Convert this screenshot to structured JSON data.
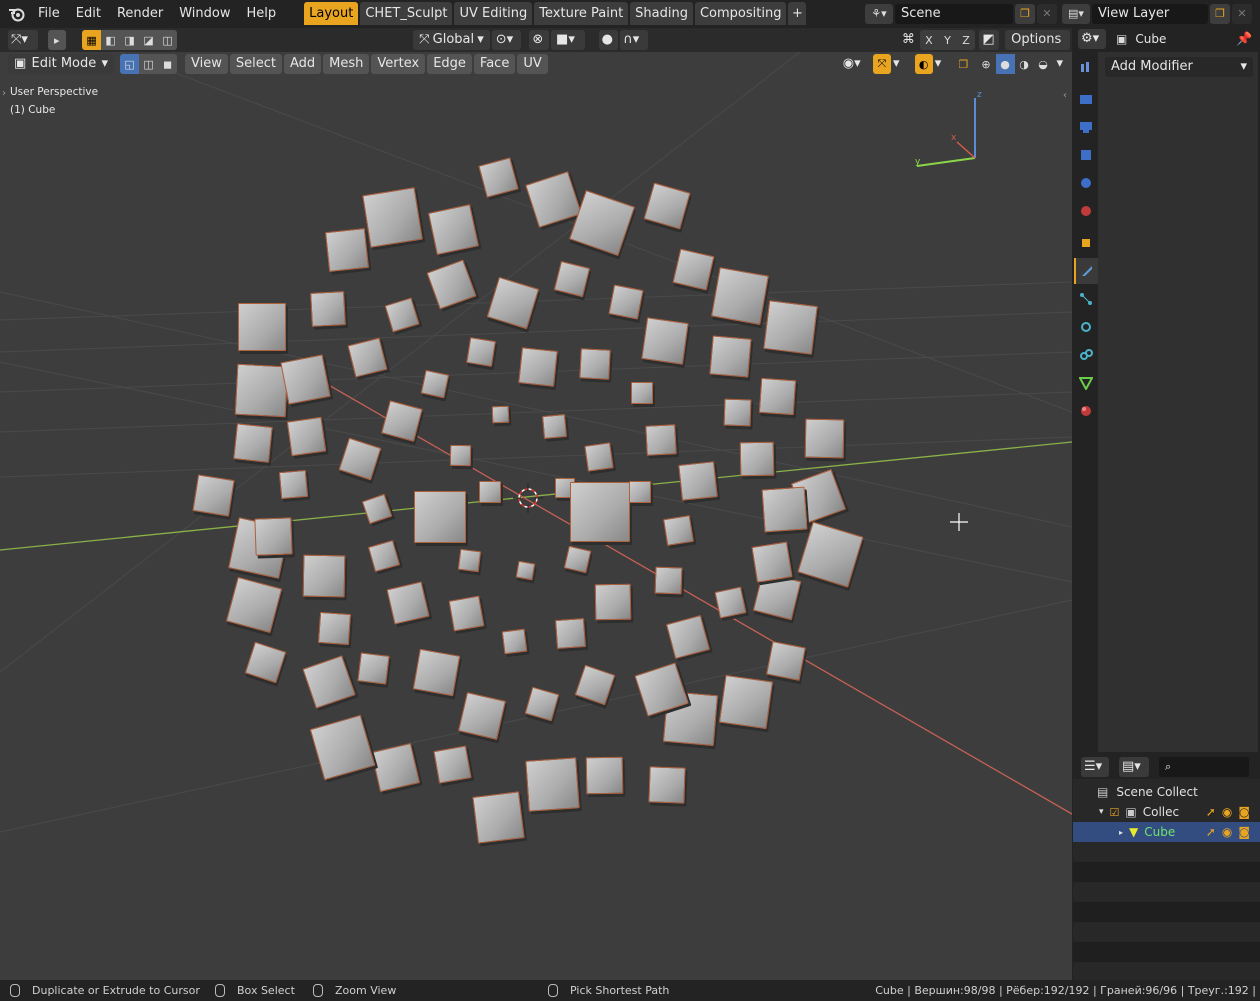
{
  "topbar": {
    "menu": [
      "File",
      "Edit",
      "Render",
      "Window",
      "Help"
    ],
    "tabs": [
      {
        "label": "Layout",
        "active": true
      },
      {
        "label": "CHET_Sculpt",
        "active": false
      },
      {
        "label": "UV Editing",
        "active": false
      },
      {
        "label": "Texture Paint",
        "active": false
      },
      {
        "label": "Shading",
        "active": false
      },
      {
        "label": "Compositing",
        "active": false
      }
    ],
    "add_tab": "+",
    "scene_name": "Scene",
    "view_layer": "View Layer"
  },
  "toolheader": {
    "transform_orientation": "Global",
    "axes": [
      "X",
      "Y",
      "Z"
    ],
    "options_label": "Options"
  },
  "editheader": {
    "mode": "Edit Mode",
    "menus": [
      "View",
      "Select",
      "Add",
      "Mesh",
      "Vertex",
      "Edge",
      "Face",
      "UV"
    ]
  },
  "viewport": {
    "perspective": "User Perspective",
    "object": "(1) Cube",
    "gizmo_axes": {
      "z": "z",
      "x": "x",
      "y": "y"
    }
  },
  "properties": {
    "object_name": "Cube",
    "add_modifier": "Add Modifier",
    "tab_icons": [
      "tool-icon",
      "render-icon",
      "output-icon",
      "view-layer-icon",
      "scene-icon",
      "world-icon",
      "object-icon",
      "modifier-icon",
      "particles-icon",
      "physics-icon",
      "constraints-icon",
      "data-icon",
      "material-icon"
    ]
  },
  "outliner": {
    "rows": [
      "Scene Collect",
      "Collec",
      "Cube"
    ]
  },
  "statusbar": {
    "left": "Duplicate or Extrude to Cursor",
    "middle": "Box Select",
    "zoom": "Zoom View",
    "pick": "Pick Shortest Path",
    "stats": "Cube | Вершин:98/98 | Рёбер:192/192 | Граней:96/96 | Треуг.:192 |"
  },
  "colors": {
    "accent": "#e9a51f",
    "selected_blue": "#4772b3",
    "edge_orange": "#b1603c"
  }
}
